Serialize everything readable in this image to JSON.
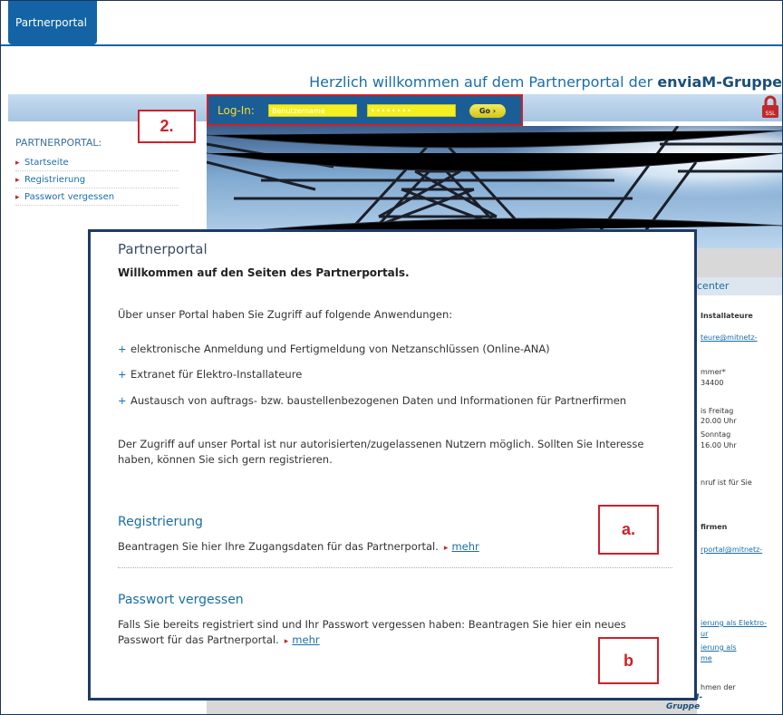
{
  "header": {
    "tab_label": "Partnerportal",
    "welcome_prefix": "Herzlich willkommen auf dem Partnerportal der ",
    "welcome_brand": "enviaM-Gruppe"
  },
  "login": {
    "label": "Log-In:",
    "username_placeholder": "Benutzername",
    "password_value": "••••••••",
    "go_label": "Go ›"
  },
  "annotations": {
    "step2": "2.",
    "a": "a.",
    "b": "b"
  },
  "sidebar": {
    "heading": "PARTNERPORTAL:",
    "items": [
      "Startseite",
      "Registrierung",
      "Passwort vergessen"
    ]
  },
  "modal": {
    "title": "Partnerportal",
    "subtitle": "Willkommen auf den Seiten des Partnerportals.",
    "intro": "Über unser Portal haben Sie Zugriff auf folgende Anwendungen:",
    "bullets": [
      "elektronische Anmeldung und Fertigmeldung von Netzanschlüssen (Online-ANA)",
      "Extranet für Elektro-Installateure",
      "Austausch von auftrags- bzw. baustellenbezogenen Daten und Informationen für Partnerfirmen"
    ],
    "access_text": "Der Zugriff auf unser Portal ist nur autorisierten/zugelassenen Nutzern möglich. Sollten Sie Interesse haben, können Sie sich gern registrieren.",
    "registration": {
      "title": "Registrierung",
      "text": "Beantragen Sie hier Ihre Zugangsdaten für das Partnerportal.",
      "link": "mehr"
    },
    "password": {
      "title": "Passwort vergessen",
      "text": "Falls Sie bereits registriert sind und Ihr Passwort vergessen haben: Beantragen Sie hier ein neues Passwort für das Partnerportal.",
      "link": "mehr"
    }
  },
  "right_column": {
    "header": "center",
    "lines": [
      "Installateure",
      "teure@mitnetz-",
      "mmer*",
      "34400",
      "is Freitag",
      "20.00 Uhr",
      "Sonntag",
      "16.00 Uhr",
      "nruf ist für Sie",
      "firmen",
      "rportal@mitnetz-",
      "ierung als Elektro-",
      "ur",
      "ierung als",
      "me",
      "hmen der"
    ],
    "logo": "enviaM-Gruppe"
  },
  "colors": {
    "brand_blue": "#1464a5",
    "accent_red": "#d0202a",
    "login_yellow": "#f4ef21"
  }
}
